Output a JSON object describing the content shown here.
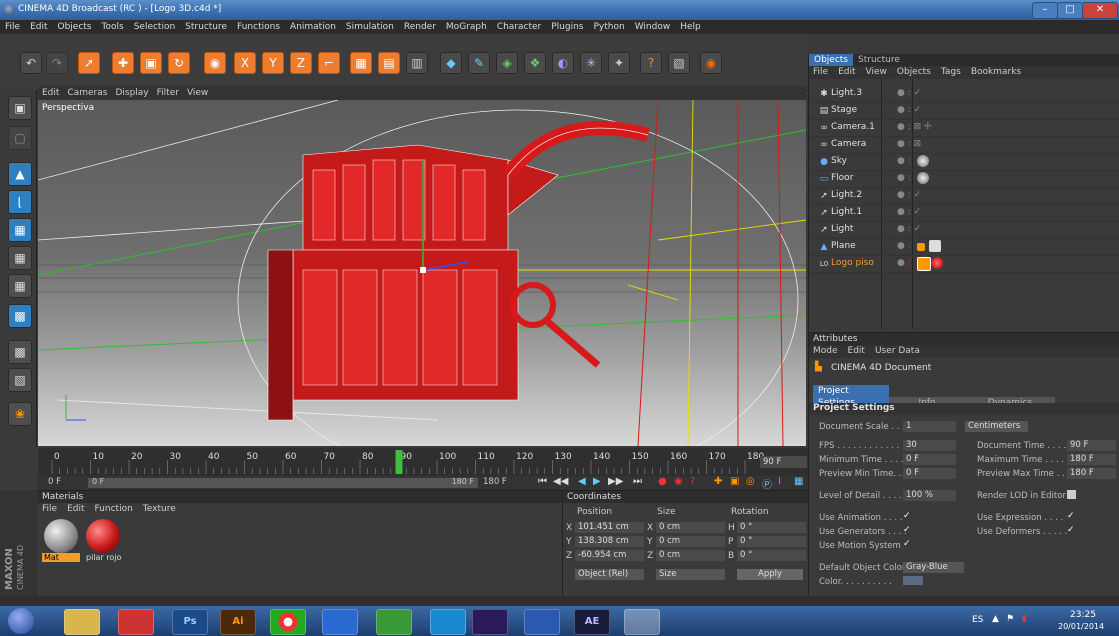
{
  "window": {
    "title": "CINEMA 4D Broadcast (RC ) - [Logo 3D.c4d *]",
    "minimize": "–",
    "maximize": "□",
    "close": "✕"
  },
  "menubar": [
    "File",
    "Edit",
    "Objects",
    "Tools",
    "Selection",
    "Structure",
    "Functions",
    "Animation",
    "Simulation",
    "Render",
    "MoGraph",
    "Character",
    "Plugins",
    "Python",
    "Window",
    "Help"
  ],
  "toolbar": {
    "tools": [
      "undo",
      "redo",
      "select",
      "move",
      "scale",
      "rotate",
      "live-select",
      "x-axis",
      "y-axis",
      "z-axis",
      "coordinate-system",
      "render-region",
      "render-view",
      "render-settings",
      "cube",
      "pen",
      "subdivision",
      "cloner",
      "deformer",
      "environment",
      "scene",
      "camera",
      "light"
    ]
  },
  "left_toolbar": [
    "model-mode",
    "object-mode",
    "texture-mode",
    "points-mode",
    "edges-mode",
    "polygons-mode",
    "workplane",
    "layout",
    "scene",
    "grid",
    "snap",
    "sphere"
  ],
  "viewport": {
    "menu": [
      "Edit",
      "Cameras",
      "Display",
      "Filter",
      "View"
    ],
    "label": "Perspectiva"
  },
  "timeline": {
    "ticks": [
      "0",
      "10",
      "20",
      "30",
      "40",
      "50",
      "60",
      "70",
      "80",
      "90",
      "100",
      "110",
      "120",
      "130",
      "140",
      "150",
      "160",
      "170",
      "180"
    ],
    "current_frame": "90",
    "end_field": "90 F",
    "start": "0 F",
    "preview_start": "0 F",
    "preview_end": "180 F",
    "end": "180 F"
  },
  "materials": {
    "header": "Materials",
    "menu": [
      "File",
      "Edit",
      "Function",
      "Texture"
    ],
    "items": [
      {
        "name": "Mat",
        "color": "#9a9a9a"
      },
      {
        "name": "pilar rojo",
        "color": "#c81818"
      }
    ]
  },
  "maxon": {
    "brand": "MAXON",
    "product": "CINEMA 4D"
  },
  "coordinates": {
    "header": "Coordinates",
    "columns": [
      "Position",
      "Size",
      "Rotation"
    ],
    "rows": [
      {
        "axis": "X",
        "pos": "101.451 cm",
        "size_axis": "X",
        "size": "0 cm",
        "rot_axis": "H",
        "rot": "0 °"
      },
      {
        "axis": "Y",
        "pos": "138.308 cm",
        "size_axis": "Y",
        "size": "0 cm",
        "rot_axis": "P",
        "rot": "0 °"
      },
      {
        "axis": "Z",
        "pos": "-60.954 cm",
        "size_axis": "Z",
        "size": "0 cm",
        "rot_axis": "B",
        "rot": "0 °"
      }
    ],
    "mode": "Object (Rel)",
    "size_mode": "Size",
    "apply": "Apply"
  },
  "objects": {
    "tabs": [
      "Objects",
      "Structure"
    ],
    "menu": [
      "File",
      "Edit",
      "View",
      "Objects",
      "Tags",
      "Bookmarks"
    ],
    "items": [
      {
        "name": "Light.3",
        "icon": "✱"
      },
      {
        "name": "Stage",
        "icon": "▤"
      },
      {
        "name": "Camera.1",
        "icon": "∞"
      },
      {
        "name": "Camera",
        "icon": "∞"
      },
      {
        "name": "Sky",
        "icon": "●"
      },
      {
        "name": "Floor",
        "icon": "▭"
      },
      {
        "name": "Light.2",
        "icon": "➚"
      },
      {
        "name": "Light.1",
        "icon": "➚"
      },
      {
        "name": "Light",
        "icon": "➚"
      },
      {
        "name": "Plane",
        "icon": "▲"
      },
      {
        "name": "Logo piso",
        "icon": "L0"
      }
    ]
  },
  "attributes": {
    "header": "Attributes",
    "menu": [
      "Mode",
      "Edit",
      "User Data"
    ],
    "document": "CINEMA 4D Document",
    "tabs": [
      "Project Settings",
      "Info",
      "Dynamics"
    ],
    "section": "Project Settings",
    "doc_scale_label": "Document Scale . .",
    "doc_scale": "1",
    "units": "Centimeters",
    "fps_label": "FPS . . . . . . . . . . . .",
    "fps": "30",
    "doc_time_label": "Document Time . . . .",
    "doc_time": "90 F",
    "min_time_label": "Minimum Time . . . .",
    "min_time": "0 F",
    "max_time_label": "Maximum Time . . . .",
    "max_time": "180 F",
    "prev_min_label": "Preview Min Time. .",
    "prev_min": "0 F",
    "prev_max_label": "Preview Max Time . .",
    "prev_max": "180 F",
    "lod_label": "Level of Detail . . . .",
    "lod": "100 %",
    "render_lod_label": "Render LOD in Editor",
    "use_anim_label": "Use Animation . . . .",
    "use_expr_label": "Use Expression . . . .",
    "use_gen_label": "Use Generators . . . .",
    "use_def_label": "Use Deformers . . . . .",
    "use_motion_label": "Use Motion System",
    "check": "✓",
    "default_color_label": "Default Object Color",
    "default_color": "Gray-Blue",
    "color_label": "Color. . . . . . . . . ."
  },
  "taskbar": {
    "apps": [
      "Explorer",
      "Tools",
      "Ps",
      "Ai",
      "Chrome",
      "Media",
      "uTorrent",
      "Skype",
      "Premiere",
      "Word",
      "AE",
      "C4D"
    ],
    "lang": "ES",
    "time": "23:25",
    "date": "20/01/2014"
  }
}
